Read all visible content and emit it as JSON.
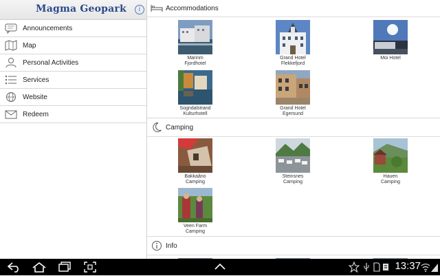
{
  "app": {
    "brand": "Magma Geopark",
    "info_symbol": "i"
  },
  "sidebar": {
    "items": [
      {
        "label": "Announcements",
        "icon": "speech-bubble-icon"
      },
      {
        "label": "Map",
        "icon": "map-icon"
      },
      {
        "label": "Personal Activities",
        "icon": "person-icon"
      },
      {
        "label": "Services",
        "icon": "list-icon"
      },
      {
        "label": "Website",
        "icon": "globe-icon"
      },
      {
        "label": "Redeem",
        "icon": "envelope-icon"
      }
    ]
  },
  "sections": [
    {
      "title": "Accommodations",
      "icon": "bed-icon",
      "tiles": [
        {
          "line1": "Marinm",
          "line2": "Fjordhotel"
        },
        {
          "line1": "Grand Hotel",
          "line2": "Flekkefjord"
        },
        {
          "line1": "Moi Hotel",
          "line2": ""
        },
        {
          "line1": "Sogndalstrand",
          "line2": "Kulturhotell"
        },
        {
          "line1": "Grand Hotel",
          "line2": "Egersund"
        }
      ]
    },
    {
      "title": "Camping",
      "icon": "moon-icon",
      "tiles": [
        {
          "line1": "Bakkaåno",
          "line2": "Camping"
        },
        {
          "line1": "Steinsnes",
          "line2": "Camping"
        },
        {
          "line1": "Hauen",
          "line2": "Camping"
        },
        {
          "line1": "Veen Farm",
          "line2": "Camping"
        }
      ]
    },
    {
      "title": "Info",
      "icon": "info-circle-icon",
      "tiles": []
    }
  ],
  "system_bar": {
    "time": "13:37",
    "icons": [
      "back-icon",
      "home-icon",
      "recent-apps-icon",
      "screenshot-icon",
      "up-arrow-icon",
      "star-icon",
      "usb-icon",
      "sd-card-icon",
      "notification-icon",
      "wifi-icon",
      "signal-icon"
    ]
  },
  "colors": {
    "brand": "#2c4a8a",
    "info_accent": "#4a78c8",
    "system_bar": "#000000",
    "divider": "#d7d7d7"
  }
}
